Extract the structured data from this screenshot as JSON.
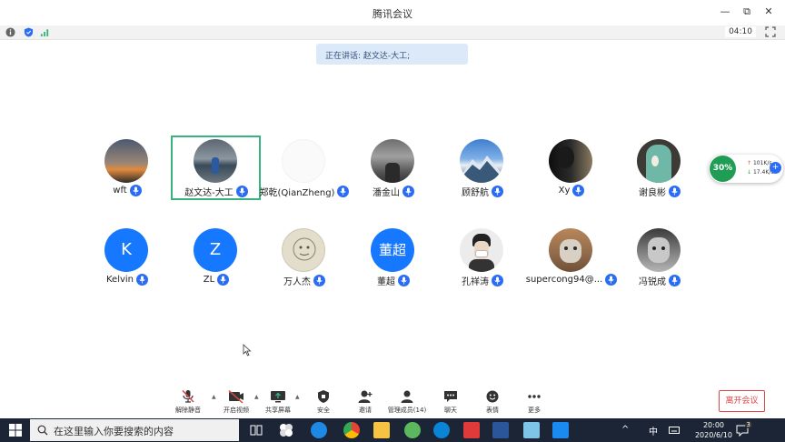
{
  "window": {
    "title": "腾讯会议"
  },
  "window_controls": {
    "minimize": "—",
    "maximize": "⧉",
    "close": "✕"
  },
  "infobar": {
    "timer": "04:10"
  },
  "speaking": {
    "text": "正在讲话: 赵文达-大工;"
  },
  "participants_row1": [
    {
      "name": "wft",
      "avatar_type": "photo"
    },
    {
      "name": "赵文达-大工",
      "avatar_type": "photo"
    },
    {
      "name": "郑乾(QianZheng)",
      "avatar_type": "photo"
    },
    {
      "name": "潘金山",
      "avatar_type": "photo"
    },
    {
      "name": "顾舒航",
      "avatar_type": "photo"
    },
    {
      "name": "Xy",
      "avatar_type": "photo"
    },
    {
      "name": "谢良彬",
      "avatar_type": "photo"
    }
  ],
  "participants_row2": [
    {
      "name": "Kelvin",
      "avatar_type": "letter",
      "letter": "K"
    },
    {
      "name": "ZL",
      "avatar_type": "letter",
      "letter": "Z"
    },
    {
      "name": "万人杰",
      "avatar_type": "photo"
    },
    {
      "name": "董超",
      "avatar_type": "letter",
      "letter": "董超"
    },
    {
      "name": "孔祥涛",
      "avatar_type": "photo"
    },
    {
      "name": "supercong94@...",
      "avatar_type": "photo"
    },
    {
      "name": "冯锐成",
      "avatar_type": "photo"
    }
  ],
  "network": {
    "percent": "30%",
    "up": "101K/s",
    "down": "17.4K/s"
  },
  "toolbar": {
    "unmute": "解除静音",
    "start_video": "开启视频",
    "share_screen": "共享屏幕",
    "security": "安全",
    "invite": "邀请",
    "manage_members": "管理成员(14)",
    "chat": "聊天",
    "reactions": "表情",
    "more": "更多",
    "leave": "离开会议"
  },
  "taskbar": {
    "search_placeholder": "在这里输入你要搜索的内容",
    "ime": "中",
    "time": "20:00",
    "date": "2020/6/10",
    "notification_count": "3"
  },
  "colors": {
    "accent": "#2a6df4",
    "active_speaker": "#36b37e",
    "leave": "#e04545",
    "taskbar": "#1c2535"
  }
}
